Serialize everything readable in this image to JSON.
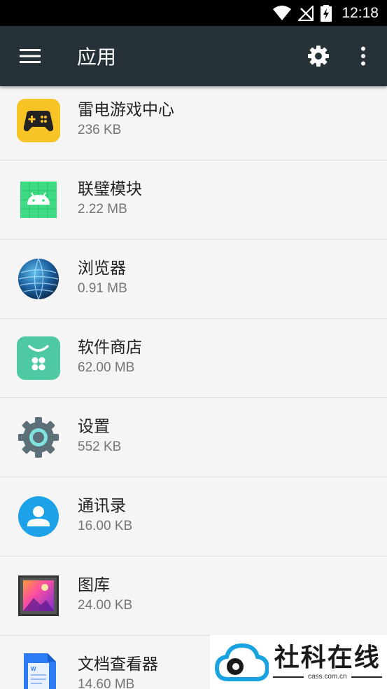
{
  "status_bar": {
    "time": "12:18",
    "icons": [
      "wifi-icon",
      "no-signal-icon",
      "battery-charging-icon"
    ]
  },
  "app_bar": {
    "title": "应用",
    "icons": [
      "menu-icon",
      "gear-icon",
      "overflow-menu-icon"
    ],
    "color": "#263238"
  },
  "apps": [
    {
      "name": "雷电游戏中心",
      "size": "236 KB",
      "icon": "gamepad-icon"
    },
    {
      "name": "联璧模块",
      "size": "2.22 MB",
      "icon": "android-icon"
    },
    {
      "name": "浏览器",
      "size": "0.91 MB",
      "icon": "globe-icon"
    },
    {
      "name": "软件商店",
      "size": "62.00 MB",
      "icon": "store-icon"
    },
    {
      "name": "设置",
      "size": "552 KB",
      "icon": "gear-icon"
    },
    {
      "name": "通讯录",
      "size": "16.00 KB",
      "icon": "contacts-icon"
    },
    {
      "name": "图库",
      "size": "24.00 KB",
      "icon": "gallery-icon"
    },
    {
      "name": "文档查看器",
      "size": "14.60 MB",
      "icon": "document-icon"
    }
  ],
  "watermark": {
    "text": "社科在线",
    "domain": "cass.com.cn"
  }
}
